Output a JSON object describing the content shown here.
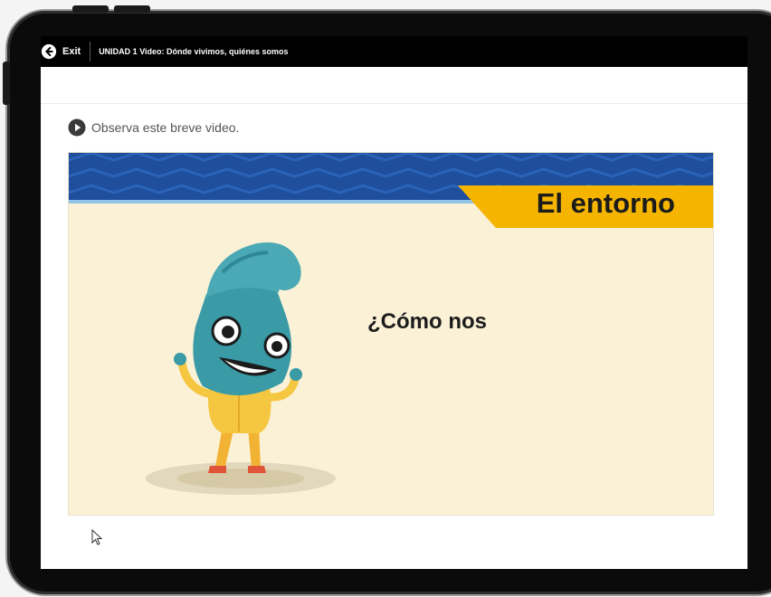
{
  "topbar": {
    "exit_label": "Exit",
    "title": "UNIDAD 1 Video: Dónde vivimos, quiénes somos"
  },
  "content": {
    "instruction": "Observa este breve video."
  },
  "video": {
    "tag": "El entorno",
    "question": "¿Cómo nos"
  },
  "icons": {
    "exit": "arrow-left-circle-icon",
    "play": "play-circle-icon",
    "cursor": "mouse-pointer-icon"
  },
  "colors": {
    "topbar": "#000000",
    "band_blue": "#1f4e9c",
    "tag_yellow": "#f4b400",
    "video_background": "#fbf1d6",
    "mascot_teal": "#3a9aa6"
  }
}
